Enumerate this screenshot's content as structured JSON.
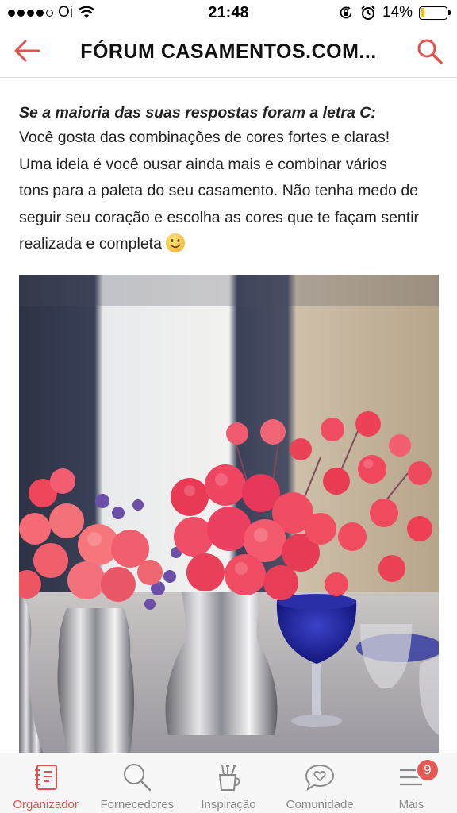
{
  "status_bar": {
    "carrier": "Oi",
    "time": "21:48",
    "battery_percent": "14%",
    "battery_level": 0.14,
    "icons": [
      "signal-dots-icon",
      "wifi-icon",
      "rotation-lock-icon",
      "alarm-icon",
      "battery-icon"
    ]
  },
  "nav": {
    "title": "FÓRUM CASAMENTOS.COM...",
    "back_icon": "back-arrow-icon",
    "search_icon": "search-icon",
    "accent_color": "#e0524f"
  },
  "post": {
    "heading": "Se a maioria das suas respostas foram a letra C:",
    "lines": [
      "Você gosta das combinações de cores fortes e claras!",
      "Uma ideia é você ousar ainda mais e combinar vários",
      "tons para a paleta do seu casamento. Não tenha medo de",
      "seguir seu coração e escolha as cores que te façam sentir",
      "realizada e completa"
    ],
    "emoji": "smiley-face-icon",
    "image": "photo of pink and coral flower arrangements in silver vases with blue glasses"
  },
  "tab_bar": {
    "tabs": [
      {
        "label": "Organizador",
        "icon": "planner-book-icon",
        "active": true
      },
      {
        "label": "Fornecedores",
        "icon": "search-icon",
        "active": false
      },
      {
        "label": "Inspiração",
        "icon": "brush-cup-icon",
        "active": false
      },
      {
        "label": "Comunidade",
        "icon": "chat-heart-icon",
        "active": false
      },
      {
        "label": "Mais",
        "icon": "menu-icon",
        "active": false,
        "badge": "9"
      }
    ]
  }
}
